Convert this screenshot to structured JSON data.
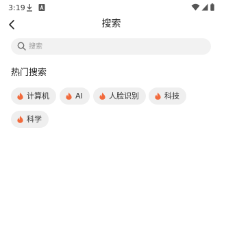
{
  "status_bar": {
    "time": "3:19",
    "icons": [
      "download-icon",
      "notification-a-icon",
      "wifi-icon",
      "signal-icon",
      "battery-icon"
    ]
  },
  "header": {
    "back_icon": "chevron-left-icon",
    "title": "搜索"
  },
  "search": {
    "placeholder": "搜索",
    "value": "",
    "icon": "search-icon"
  },
  "hot_search": {
    "title": "热门搜索",
    "icon": "flame-icon",
    "items": [
      {
        "label": "计算机"
      },
      {
        "label": "AI"
      },
      {
        "label": "人脸识别"
      },
      {
        "label": "科技"
      },
      {
        "label": "科学"
      }
    ]
  },
  "colors": {
    "flame": "#f26a3c",
    "chip_bg": "#efefef",
    "search_bg": "#f2f2f2"
  }
}
